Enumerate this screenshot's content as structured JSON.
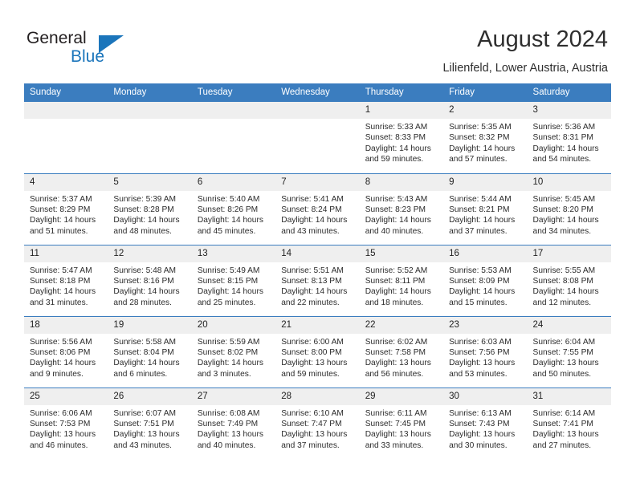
{
  "logo": {
    "word_top": "General",
    "word_bottom": "Blue",
    "accent_color": "#1b75bb",
    "triangle_icon": "blue-triangle-icon"
  },
  "header": {
    "title": "August 2024",
    "subtitle": "Lilienfeld, Lower Austria, Austria",
    "header_bar_color": "#3b7dbf"
  },
  "weekdays": [
    "Sunday",
    "Monday",
    "Tuesday",
    "Wednesday",
    "Thursday",
    "Friday",
    "Saturday"
  ],
  "weeks": [
    [
      {
        "day": "",
        "lines": []
      },
      {
        "day": "",
        "lines": []
      },
      {
        "day": "",
        "lines": []
      },
      {
        "day": "",
        "lines": []
      },
      {
        "day": "1",
        "lines": [
          "Sunrise: 5:33 AM",
          "Sunset: 8:33 PM",
          "Daylight: 14 hours",
          "and 59 minutes."
        ]
      },
      {
        "day": "2",
        "lines": [
          "Sunrise: 5:35 AM",
          "Sunset: 8:32 PM",
          "Daylight: 14 hours",
          "and 57 minutes."
        ]
      },
      {
        "day": "3",
        "lines": [
          "Sunrise: 5:36 AM",
          "Sunset: 8:31 PM",
          "Daylight: 14 hours",
          "and 54 minutes."
        ]
      }
    ],
    [
      {
        "day": "4",
        "lines": [
          "Sunrise: 5:37 AM",
          "Sunset: 8:29 PM",
          "Daylight: 14 hours",
          "and 51 minutes."
        ]
      },
      {
        "day": "5",
        "lines": [
          "Sunrise: 5:39 AM",
          "Sunset: 8:28 PM",
          "Daylight: 14 hours",
          "and 48 minutes."
        ]
      },
      {
        "day": "6",
        "lines": [
          "Sunrise: 5:40 AM",
          "Sunset: 8:26 PM",
          "Daylight: 14 hours",
          "and 45 minutes."
        ]
      },
      {
        "day": "7",
        "lines": [
          "Sunrise: 5:41 AM",
          "Sunset: 8:24 PM",
          "Daylight: 14 hours",
          "and 43 minutes."
        ]
      },
      {
        "day": "8",
        "lines": [
          "Sunrise: 5:43 AM",
          "Sunset: 8:23 PM",
          "Daylight: 14 hours",
          "and 40 minutes."
        ]
      },
      {
        "day": "9",
        "lines": [
          "Sunrise: 5:44 AM",
          "Sunset: 8:21 PM",
          "Daylight: 14 hours",
          "and 37 minutes."
        ]
      },
      {
        "day": "10",
        "lines": [
          "Sunrise: 5:45 AM",
          "Sunset: 8:20 PM",
          "Daylight: 14 hours",
          "and 34 minutes."
        ]
      }
    ],
    [
      {
        "day": "11",
        "lines": [
          "Sunrise: 5:47 AM",
          "Sunset: 8:18 PM",
          "Daylight: 14 hours",
          "and 31 minutes."
        ]
      },
      {
        "day": "12",
        "lines": [
          "Sunrise: 5:48 AM",
          "Sunset: 8:16 PM",
          "Daylight: 14 hours",
          "and 28 minutes."
        ]
      },
      {
        "day": "13",
        "lines": [
          "Sunrise: 5:49 AM",
          "Sunset: 8:15 PM",
          "Daylight: 14 hours",
          "and 25 minutes."
        ]
      },
      {
        "day": "14",
        "lines": [
          "Sunrise: 5:51 AM",
          "Sunset: 8:13 PM",
          "Daylight: 14 hours",
          "and 22 minutes."
        ]
      },
      {
        "day": "15",
        "lines": [
          "Sunrise: 5:52 AM",
          "Sunset: 8:11 PM",
          "Daylight: 14 hours",
          "and 18 minutes."
        ]
      },
      {
        "day": "16",
        "lines": [
          "Sunrise: 5:53 AM",
          "Sunset: 8:09 PM",
          "Daylight: 14 hours",
          "and 15 minutes."
        ]
      },
      {
        "day": "17",
        "lines": [
          "Sunrise: 5:55 AM",
          "Sunset: 8:08 PM",
          "Daylight: 14 hours",
          "and 12 minutes."
        ]
      }
    ],
    [
      {
        "day": "18",
        "lines": [
          "Sunrise: 5:56 AM",
          "Sunset: 8:06 PM",
          "Daylight: 14 hours",
          "and 9 minutes."
        ]
      },
      {
        "day": "19",
        "lines": [
          "Sunrise: 5:58 AM",
          "Sunset: 8:04 PM",
          "Daylight: 14 hours",
          "and 6 minutes."
        ]
      },
      {
        "day": "20",
        "lines": [
          "Sunrise: 5:59 AM",
          "Sunset: 8:02 PM",
          "Daylight: 14 hours",
          "and 3 minutes."
        ]
      },
      {
        "day": "21",
        "lines": [
          "Sunrise: 6:00 AM",
          "Sunset: 8:00 PM",
          "Daylight: 13 hours",
          "and 59 minutes."
        ]
      },
      {
        "day": "22",
        "lines": [
          "Sunrise: 6:02 AM",
          "Sunset: 7:58 PM",
          "Daylight: 13 hours",
          "and 56 minutes."
        ]
      },
      {
        "day": "23",
        "lines": [
          "Sunrise: 6:03 AM",
          "Sunset: 7:56 PM",
          "Daylight: 13 hours",
          "and 53 minutes."
        ]
      },
      {
        "day": "24",
        "lines": [
          "Sunrise: 6:04 AM",
          "Sunset: 7:55 PM",
          "Daylight: 13 hours",
          "and 50 minutes."
        ]
      }
    ],
    [
      {
        "day": "25",
        "lines": [
          "Sunrise: 6:06 AM",
          "Sunset: 7:53 PM",
          "Daylight: 13 hours",
          "and 46 minutes."
        ]
      },
      {
        "day": "26",
        "lines": [
          "Sunrise: 6:07 AM",
          "Sunset: 7:51 PM",
          "Daylight: 13 hours",
          "and 43 minutes."
        ]
      },
      {
        "day": "27",
        "lines": [
          "Sunrise: 6:08 AM",
          "Sunset: 7:49 PM",
          "Daylight: 13 hours",
          "and 40 minutes."
        ]
      },
      {
        "day": "28",
        "lines": [
          "Sunrise: 6:10 AM",
          "Sunset: 7:47 PM",
          "Daylight: 13 hours",
          "and 37 minutes."
        ]
      },
      {
        "day": "29",
        "lines": [
          "Sunrise: 6:11 AM",
          "Sunset: 7:45 PM",
          "Daylight: 13 hours",
          "and 33 minutes."
        ]
      },
      {
        "day": "30",
        "lines": [
          "Sunrise: 6:13 AM",
          "Sunset: 7:43 PM",
          "Daylight: 13 hours",
          "and 30 minutes."
        ]
      },
      {
        "day": "31",
        "lines": [
          "Sunrise: 6:14 AM",
          "Sunset: 7:41 PM",
          "Daylight: 13 hours",
          "and 27 minutes."
        ]
      }
    ]
  ]
}
